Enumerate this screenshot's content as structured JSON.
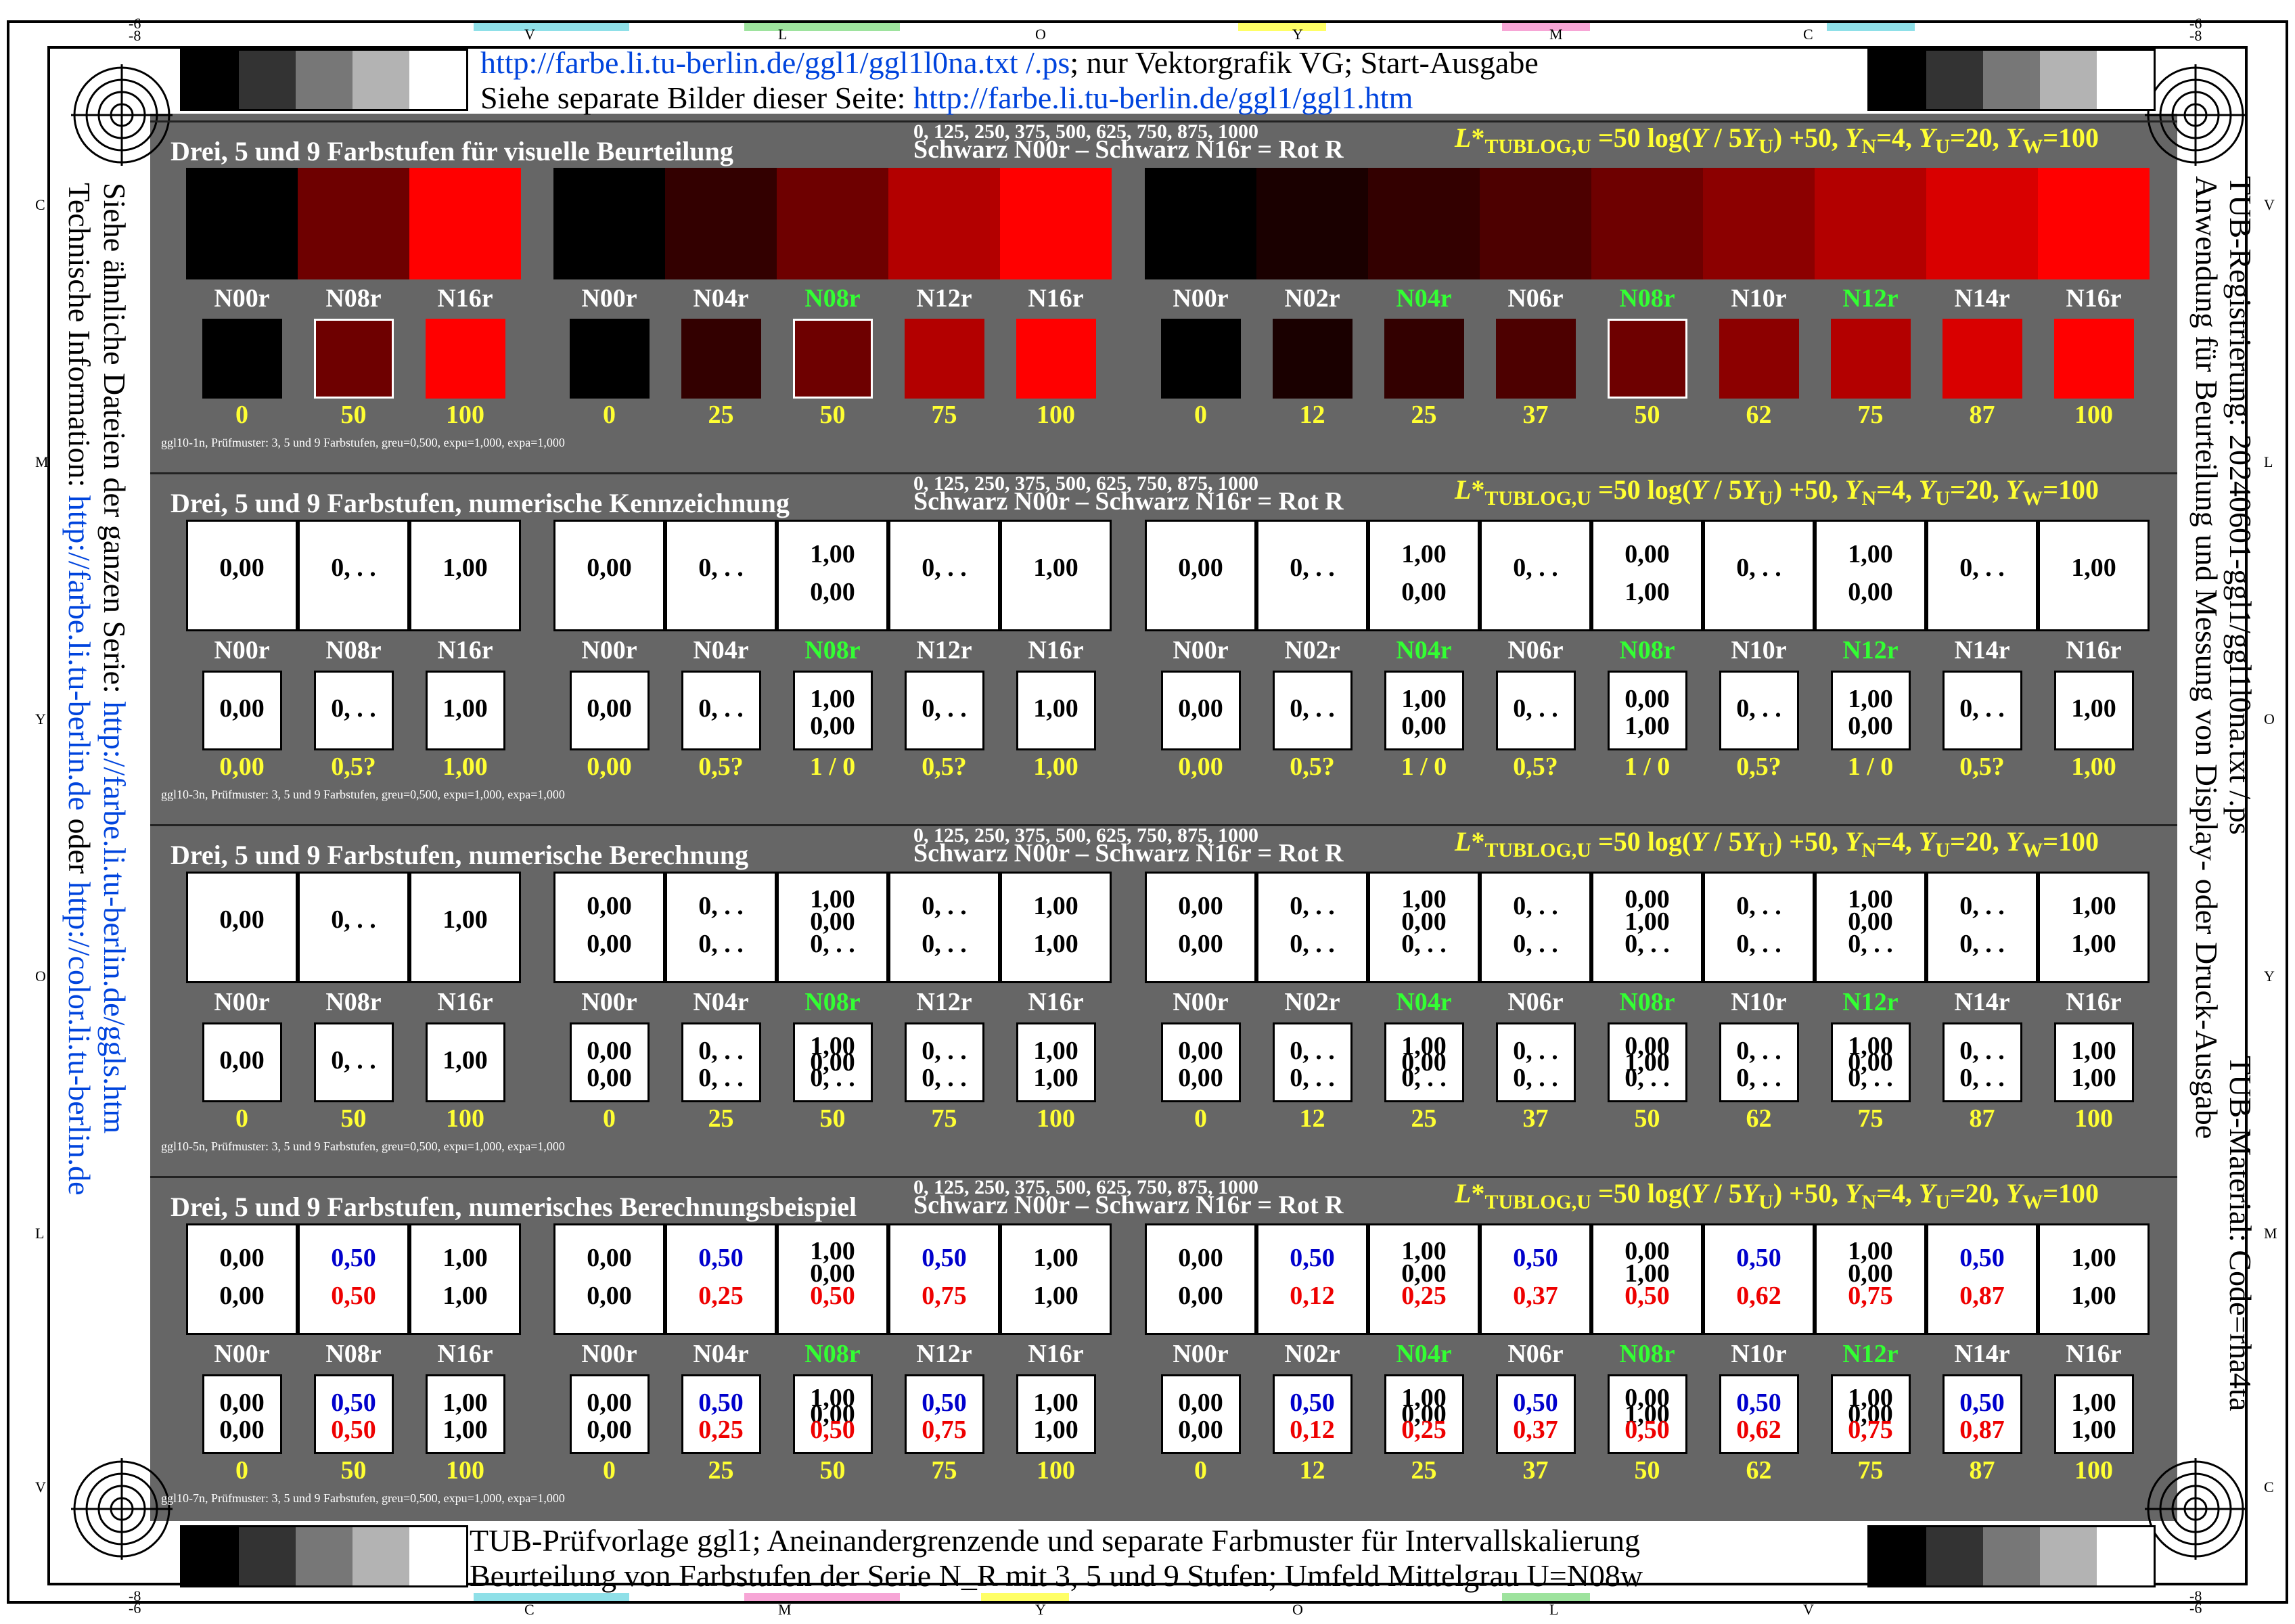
{
  "header": {
    "line1_link": "http://farbe.li.tu-berlin.de/ggl1/ggl1l0na.txt /.ps",
    "line1_text": "; nur Vektorgrafik VG; Start-Ausgabe",
    "line2_text": "Siehe separate Bilder dieser Seite: ",
    "line2_link": "http://farbe.li.tu-berlin.de/ggl1/ggl1.htm"
  },
  "footer": {
    "line1": "TUB-Prüfvorlage ggl1; Aneinandergrenzende und separate Farbmuster für Intervallskalierung",
    "line2": "Beurteilung von Farbstufen der Serie N_R mit 3, 5 und 9 Stufen; Umfeld Mittelgrau U=N08w"
  },
  "left_side": {
    "line1_text": "Siehe ähnliche Dateien der ganzen Serie: ",
    "line1_link": "http://farbe.li.tu-berlin.de/ggls.htm",
    "line2_text": "Technische Information: ",
    "line2_link1": "http://farbe.li.tu-berlin.de",
    "line2_mid": " oder ",
    "line2_link2": "http://color.li.tu-berlin.de"
  },
  "right_side": {
    "line1": "TUB-Registrierung: 20240601-ggl1/ggl1l0na.txt /.ps",
    "line2": "Anwendung für Beurteilung und Messung von Display- oder Druck-Ausgabe",
    "line3": "TUB-Material: Code=rha4ta"
  },
  "frame_ticks": {
    "top": [
      "V",
      "L",
      "O",
      "Y",
      "M",
      "C"
    ],
    "bottom": [
      "C",
      "M",
      "Y",
      "O",
      "L",
      "V"
    ],
    "left": [
      "C",
      "M",
      "Y",
      "O",
      "L",
      "V"
    ],
    "right": [
      "V",
      "L",
      "O",
      "Y",
      "M",
      "C"
    ],
    "corner_top": [
      "-6",
      "-8"
    ],
    "corner_bottom": [
      "-8",
      "-6"
    ]
  },
  "gray_strip_colors": [
    "#000000",
    "#333333",
    "#777777",
    "#b3b3b3",
    "#ffffff"
  ],
  "common": {
    "scale_line": "0, 125, 250, 375, 500, 625, 750, 875, 1000",
    "series_line": "Schwarz N00r – Schwarz N16r = Rot R",
    "formula": "L*TUBLOG,U =50 log(Y / 5YU) +50, YN=4, YU=20, YW=100",
    "labels3": [
      "N00r",
      "N08r",
      "N16r"
    ],
    "labels5": [
      "N00r",
      "N04r",
      "N08r",
      "N12r",
      "N16r"
    ],
    "labels9": [
      "N00r",
      "N02r",
      "N04r",
      "N06r",
      "N08r",
      "N10r",
      "N12r",
      "N14r",
      "N16r"
    ],
    "pct3": [
      "0",
      "50",
      "100"
    ],
    "pct5": [
      "0",
      "25",
      "50",
      "75",
      "100"
    ],
    "pct9": [
      "0",
      "12",
      "25",
      "37",
      "50",
      "62",
      "75",
      "87",
      "100"
    ],
    "colors3": [
      "#000000",
      "#6e0000",
      "#ff0000"
    ],
    "colors5": [
      "#000000",
      "#330000",
      "#6e0000",
      "#b30000",
      "#ff0000"
    ],
    "colors9": [
      "#000000",
      "#1a0000",
      "#330000",
      "#4d0000",
      "#6e0000",
      "#8c0000",
      "#b30000",
      "#d90000",
      "#ff0000"
    ]
  },
  "panels": [
    {
      "title": "Drei, 5 und 9 Farbstufen für visuelle Beurteilung",
      "subline": "ggl10-1n, Prüfmuster: 3, 5 und 9 Farbstufen, greu=0,500, expu=1,000, expa=1,000"
    },
    {
      "title": "Drei, 5 und 9 Farbstufen, numerische Kennzeichnung",
      "subline": "ggl10-3n, Prüfmuster: 3, 5 und 9 Farbstufen, greu=0,500, expu=1,000, expa=1,000",
      "cells3": [
        [
          "0,00"
        ],
        [
          "0, . ."
        ],
        [
          "1,00"
        ]
      ],
      "cells5": [
        [
          "0,00"
        ],
        [
          "0, . ."
        ],
        [
          "1,00",
          "0,00"
        ],
        [
          "0, . ."
        ],
        [
          "1,00"
        ]
      ],
      "cells9": [
        [
          "0,00"
        ],
        [
          "0, . ."
        ],
        [
          "1,00",
          "0,00"
        ],
        [
          "0, . ."
        ],
        [
          "0,00",
          "1,00"
        ],
        [
          "0, . ."
        ],
        [
          "1,00",
          "0,00"
        ],
        [
          "0, . ."
        ],
        [
          "1,00"
        ]
      ],
      "bottom3": [
        "0,00",
        "0,5?",
        "1,00"
      ],
      "bottom5": [
        "0,00",
        "0,5?",
        "1 / 0",
        "0,5?",
        "1,00"
      ],
      "bottom9": [
        "0,00",
        "0,5?",
        "1 / 0",
        "0,5?",
        "1 / 0",
        "0,5?",
        "1 / 0",
        "0,5?",
        "1,00"
      ]
    },
    {
      "title": "Drei, 5 und 9 Farbstufen, numerische Berechnung",
      "subline": "ggl10-5n, Prüfmuster: 3, 5 und 9 Farbstufen, greu=0,500, expu=1,000, expa=1,000",
      "cells3": [
        [
          "0,00"
        ],
        [
          "0, . ."
        ],
        [
          "1,00"
        ]
      ],
      "cells5": [
        [
          "0,00",
          "0,00"
        ],
        [
          "0, . .",
          "0, . ."
        ],
        [
          "1,00",
          "0,00",
          "0, . ."
        ],
        [
          "0, . .",
          "0, . ."
        ],
        [
          "1,00",
          "1,00"
        ]
      ],
      "cells9": [
        [
          "0,00",
          "0,00"
        ],
        [
          "0, . .",
          "0, . ."
        ],
        [
          "1,00",
          "0,00",
          "0, . ."
        ],
        [
          "0, . .",
          "0, . ."
        ],
        [
          "0,00",
          "1,00",
          "0, . ."
        ],
        [
          "0, . .",
          "0, . ."
        ],
        [
          "1,00",
          "0,00",
          "0, . ."
        ],
        [
          "0, . .",
          "0, . ."
        ],
        [
          "1,00",
          "1,00"
        ]
      ]
    },
    {
      "title": "Drei, 5 und 9 Farbstufen, numerisches Berechnungsbeispiel",
      "subline": "ggl10-7n, Prüfmuster: 3, 5 und 9 Farbstufen, greu=0,500, expu=1,000, expa=1,000",
      "cells3": [
        [
          "0,00",
          "0,00"
        ],
        [
          "0,50",
          "0,50"
        ],
        [
          "1,00",
          "1,00"
        ]
      ],
      "cells5": [
        [
          "0,00",
          "0,00"
        ],
        [
          "0,50",
          "0,25"
        ],
        [
          "1,00",
          "0,00",
          "0,50"
        ],
        [
          "0,50",
          "0,75"
        ],
        [
          "1,00",
          "1,00"
        ]
      ],
      "cells9": [
        [
          "0,00",
          "0,00"
        ],
        [
          "0,50",
          "0,12"
        ],
        [
          "1,00",
          "0,00",
          "0,25"
        ],
        [
          "0,50",
          "0,37"
        ],
        [
          "0,00",
          "1,00",
          "0,50"
        ],
        [
          "0,50",
          "0,62"
        ],
        [
          "1,00",
          "0,00",
          "0,75"
        ],
        [
          "0,50",
          "0,87"
        ],
        [
          "1,00",
          "1,00"
        ]
      ]
    }
  ]
}
